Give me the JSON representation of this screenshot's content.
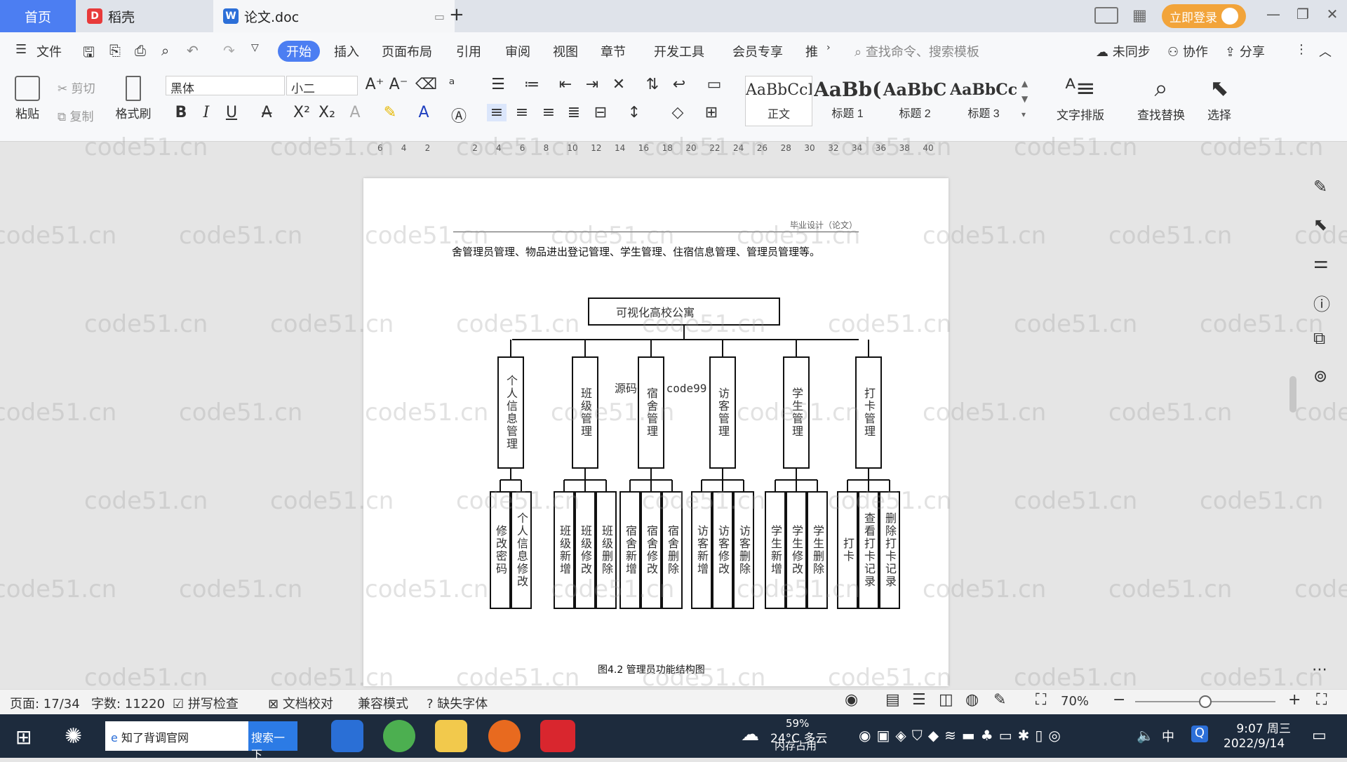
{
  "tabs": {
    "home": "首页",
    "daoke": "稻壳",
    "doc": "论文.doc",
    "add": "+"
  },
  "login": "立即登录",
  "menu": [
    "文件",
    "开始",
    "插入",
    "页面布局",
    "引用",
    "审阅",
    "视图",
    "章节",
    "开发工具",
    "会员专享",
    "推"
  ],
  "search_placeholder": "查找命令、搜索模板",
  "right_menu": {
    "sync": "未同步",
    "collab": "协作",
    "share": "分享"
  },
  "ribbon": {
    "paste": "粘贴",
    "cut": "剪切",
    "copy": "复制",
    "format_painter": "格式刷",
    "font": "黑体",
    "size": "小二",
    "text_layout": "文字排版",
    "find_replace": "查找替换",
    "select": "选择"
  },
  "styles": [
    {
      "sample": "AaBbCcI",
      "name": "正文"
    },
    {
      "sample": "AaBb(",
      "name": "标题 1"
    },
    {
      "sample": "AaBbC",
      "name": "标题 2"
    },
    {
      "sample": "AaBbCcI",
      "name": "标题 3"
    }
  ],
  "ruler": [
    "6",
    "4",
    "2",
    "",
    "2",
    "4",
    "6",
    "8",
    "10",
    "12",
    "14",
    "16",
    "18",
    "20",
    "22",
    "24",
    "26",
    "28",
    "30",
    "32",
    "34",
    "36",
    "38",
    "40"
  ],
  "doc": {
    "header": "毕业设计（论文）",
    "body": "舍管理员管理、物品进出登记管理、学生管理、住宿信息管理、管理员管理等。",
    "overlay": "源码久久-code99.top",
    "caption": "图4.2 管理员功能结构图"
  },
  "diagram": {
    "root": "可视化高校公寓",
    "modules": [
      {
        "name": "个人信息管理",
        "children": [
          "修改密码",
          "个人信息修改"
        ]
      },
      {
        "name": "班级管理",
        "children": [
          "班级新增",
          "班级修改",
          "班级删除"
        ]
      },
      {
        "name": "宿舍管理",
        "children": [
          "宿舍新增",
          "宿舍修改",
          "宿舍删除"
        ]
      },
      {
        "name": "访客管理",
        "children": [
          "访客新增",
          "访客修改",
          "访客删除"
        ]
      },
      {
        "name": "学生管理",
        "children": [
          "学生新增",
          "学生修改",
          "学生删除"
        ]
      },
      {
        "name": "打卡管理",
        "children": [
          "打卡",
          "查看打卡记录",
          "删除打卡记录"
        ]
      }
    ]
  },
  "watermark": "code51.cn",
  "status": {
    "page": "页面: 17/34",
    "words": "字数: 11220",
    "spell": "拼写检查",
    "proof": "文档校对",
    "compat": "兼容模式",
    "font_missing": "缺失字体",
    "zoom": "70%",
    "zoom_level": 0.5
  },
  "taskbar": {
    "search_text": "知了背调官网",
    "search_btn": "搜索一下",
    "weather": "24°C 多云",
    "mem": "59%",
    "mem_label": "内存占用",
    "ime": "中",
    "time": "9:07 周三",
    "date": "2022/9/14"
  }
}
